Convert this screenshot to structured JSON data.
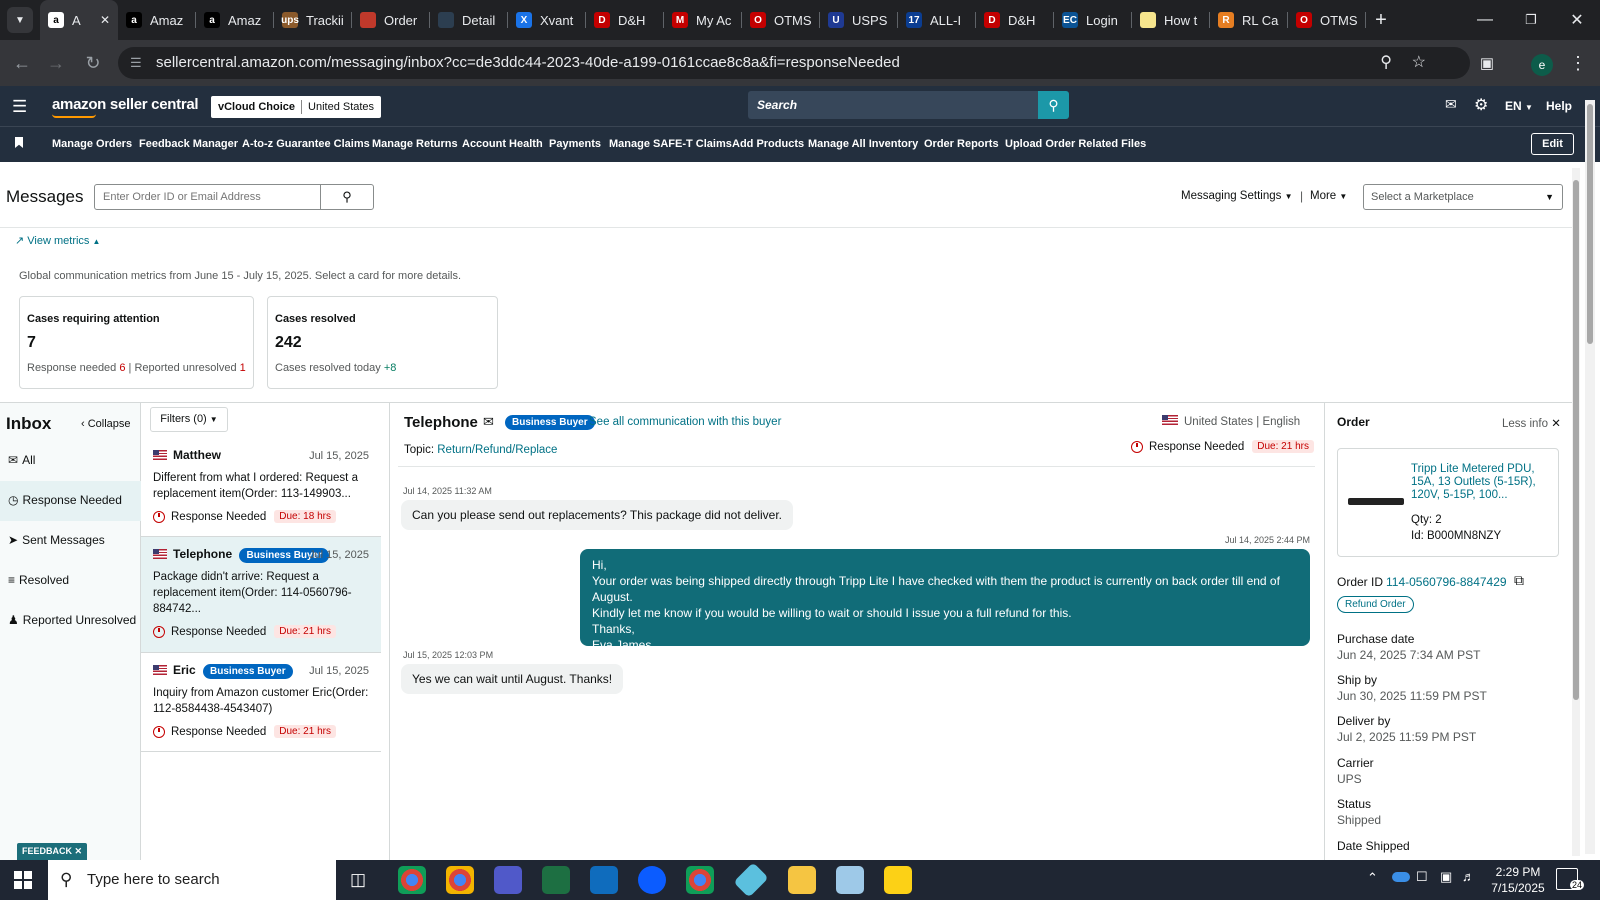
{
  "browser": {
    "tabs": [
      "A",
      "Amaz",
      "Amaz",
      "Trackii",
      "Order",
      "Detail",
      "Xvant",
      "D&H",
      "My Ac",
      "OTMS",
      "USPS",
      "ALL-I",
      "D&H",
      "Login",
      "How t",
      "RL Ca",
      "OTMS"
    ],
    "new_tab": "+",
    "url": "sellercentral.amazon.com/messaging/inbox?cc=de3ddc44-2023-40de-a199-0161ccae8c8a&fi=responseNeeded",
    "profile": "e"
  },
  "header": {
    "logo": "amazon seller central",
    "account": "vCloud Choice",
    "marketplace": "United States",
    "search_placeholder": "Search",
    "lang": "EN",
    "help": "Help"
  },
  "nav": {
    "links": [
      "Manage Orders",
      "Feedback Manager",
      "A-to-z Guarantee Claims",
      "Manage Returns",
      "Account Health",
      "Payments",
      "Manage SAFE-T Claims",
      "Add Products",
      "Manage All Inventory",
      "Order Reports",
      "Upload Order Related Files"
    ],
    "edit": "Edit"
  },
  "messages": {
    "title": "Messages",
    "search_placeholder": "Enter Order ID or Email Address",
    "settings": "Messaging Settings",
    "more": "More",
    "marketplace_placeholder": "Select a Marketplace",
    "view_metrics": "View metrics",
    "metrics_caption": "Global communication metrics from June 15 - July 15, 2025. Select a card for more details.",
    "card1": {
      "title": "Cases requiring attention",
      "value": "7",
      "line_label1": "Response needed",
      "line_val1": "6",
      "line_label2": "Reported unresolved",
      "line_val2": "1"
    },
    "card2": {
      "title": "Cases resolved",
      "value": "242",
      "line_label": "Cases resolved today",
      "line_val": "+8"
    }
  },
  "inbox": {
    "title": "Inbox",
    "collapse": "Collapse",
    "filters": "Filters (0)",
    "nav": [
      "All",
      "Response Needed",
      "Sent Messages",
      "Resolved",
      "Reported Unresolved"
    ],
    "conversations": [
      {
        "name": "Matthew",
        "badge": "",
        "date": "Jul 15, 2025",
        "preview": "Different from what I ordered: Request a replacement item(Order: 113-149903...",
        "status": "Response Needed",
        "due": "Due: 18 hrs"
      },
      {
        "name": "Telephone",
        "badge": "Business Buyer",
        "date": "Jul 15, 2025",
        "preview": "Package didn't arrive: Request a replacement item(Order: 114-0560796-884742...",
        "status": "Response Needed",
        "due": "Due: 21 hrs"
      },
      {
        "name": "Eric",
        "badge": "Business Buyer",
        "date": "Jul 15, 2025",
        "preview": "Inquiry from Amazon customer Eric(Order: 112-8584438-4543407)",
        "status": "Response Needed",
        "due": "Due: 21 hrs"
      }
    ]
  },
  "thread": {
    "buyer": "Telephone",
    "badge": "Business Buyer",
    "see_all": "See all communication with this buyer",
    "country": "United States",
    "language": "English",
    "topic_label": "Topic:",
    "topic": "Return/Refund/Replace",
    "status": "Response Needed",
    "due": "Due: 21 hrs",
    "messages": [
      {
        "time": "Jul 14, 2025 11:32 AM",
        "text": "Can you please send out replacements?  This package did not deliver."
      },
      {
        "time": "Jul 14, 2025 2:44 PM",
        "lines": [
          "Hi,",
          "Your order was being shipped directly through Tripp Lite I have checked with them the product is currently on back order till end of August.",
          "Kindly let me know if you would be willing to wait or should I issue you a full refund for this.",
          "Thanks,",
          "Eva James."
        ]
      },
      {
        "time": "Jul 15, 2025 12:03 PM",
        "text": "Yes we can wait until August.  Thanks!"
      }
    ]
  },
  "order": {
    "title": "Order",
    "less_info": "Less info",
    "product": "Tripp Lite Metered PDU, 15A, 13 Outlets (5-15R), 120V, 5-15P, 100...",
    "qty": "Qty: 2",
    "id": "Id: B000MN8NZY",
    "order_id_label": "Order ID",
    "order_id": "114-0560796-8847429",
    "refund": "Refund Order",
    "fields": [
      {
        "label": "Purchase date",
        "value": "Jun 24, 2025 7:34 AM PST"
      },
      {
        "label": "Ship by",
        "value": "Jun 30, 2025 11:59 PM PST"
      },
      {
        "label": "Deliver by",
        "value": "Jul 2, 2025 11:59 PM PST"
      },
      {
        "label": "Carrier",
        "value": "UPS"
      },
      {
        "label": "Status",
        "value": "Shipped"
      },
      {
        "label": "Date Shipped",
        "value": ""
      }
    ]
  },
  "feedback": "FEEDBACK",
  "taskbar": {
    "search_placeholder": "Type here to search",
    "time": "2:29 PM",
    "date": "7/15/2025",
    "notifications": "24"
  }
}
